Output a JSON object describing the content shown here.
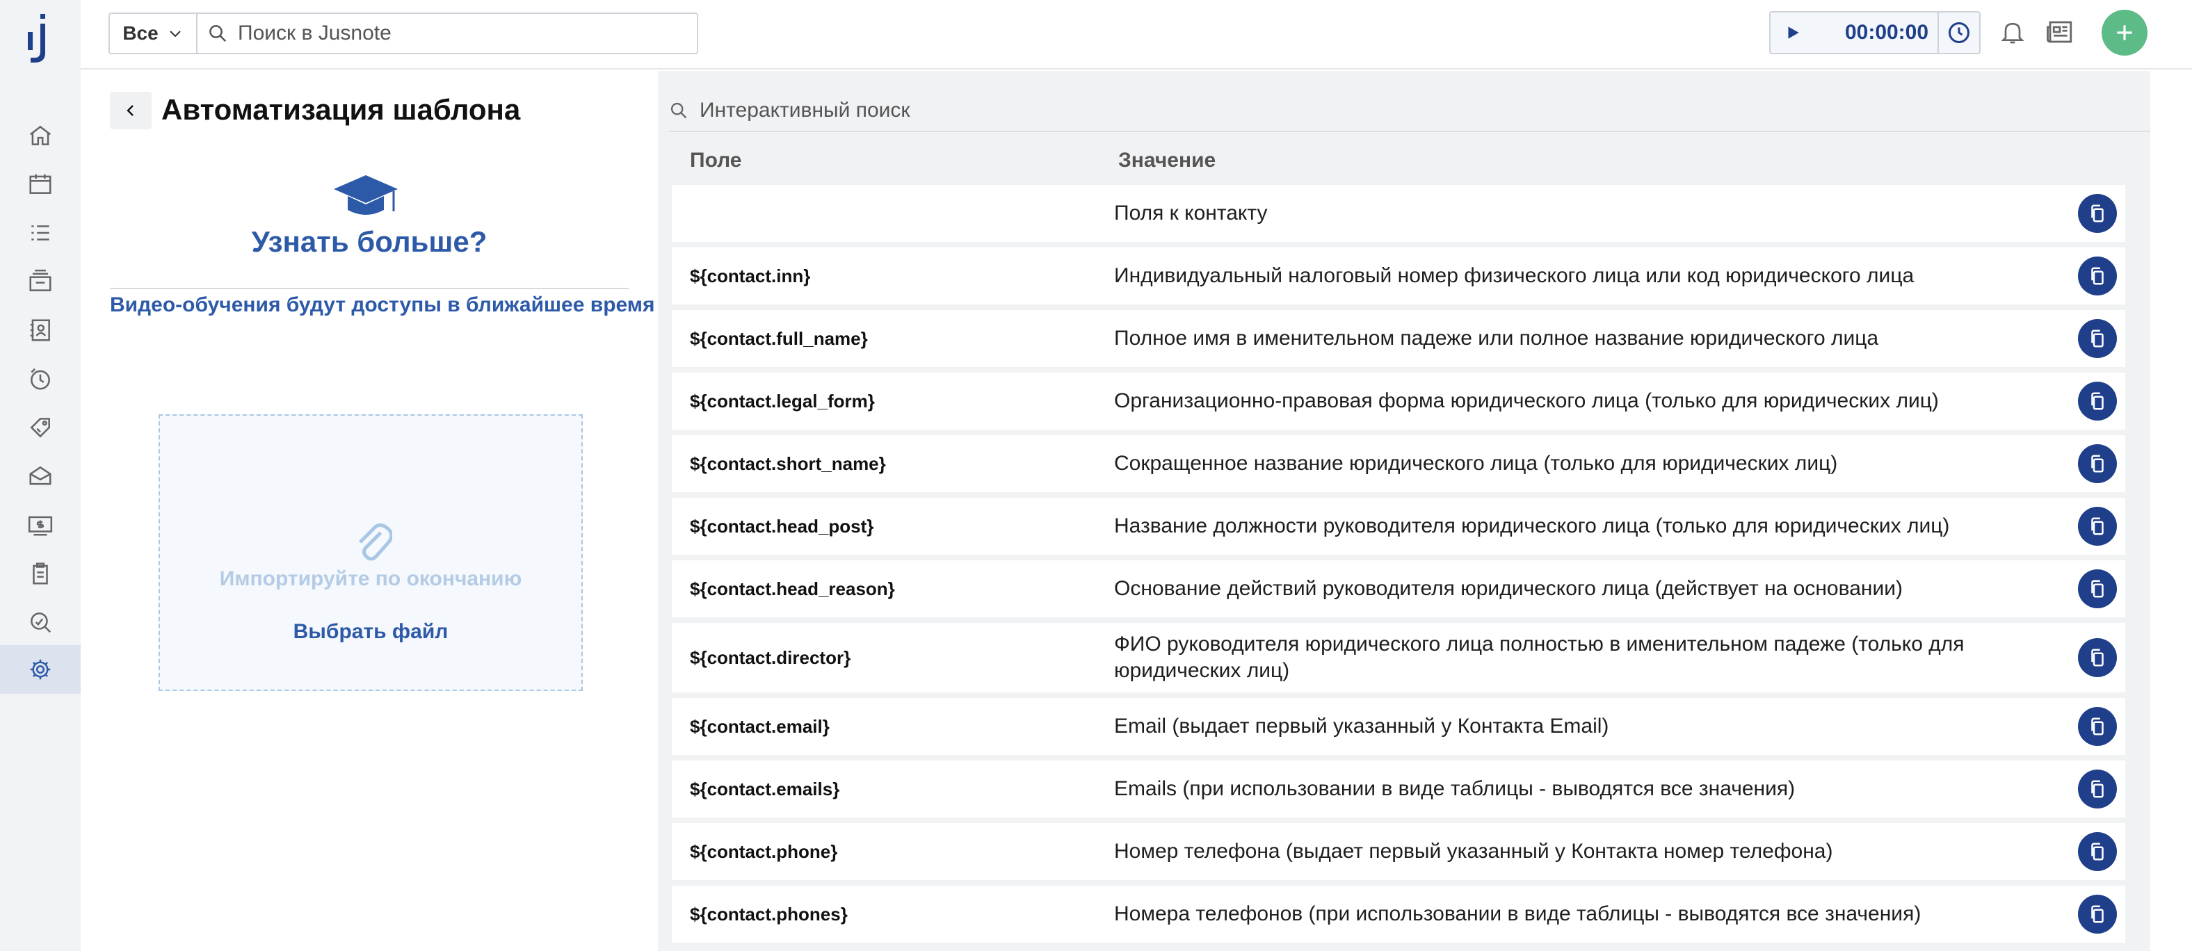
{
  "header": {
    "scope": "Все",
    "search_placeholder": "Поиск в Jusnote",
    "timer": "00:00:00"
  },
  "sidebar": {
    "items": [
      "home-icon",
      "calendar-icon",
      "tasks-icon",
      "cases-icon",
      "contacts-icon",
      "time-icon",
      "tags-icon",
      "billing-icon",
      "finance-icon",
      "documents-icon",
      "reports-icon",
      "settings-icon"
    ],
    "active": "settings-icon"
  },
  "left": {
    "title": "Автоматизация шаблона",
    "learn_more": "Узнать больше?",
    "video_note": "Видео-обучения будут доступы в ближайшее время",
    "drop_text": "Импортируйте по окончанию",
    "choose_file": "Выбрать файл"
  },
  "right": {
    "search_placeholder": "Интерактивный поиск",
    "col_field": "Поле",
    "col_value": "Значение",
    "rows": [
      {
        "field": "",
        "value": "Поля к контакту"
      },
      {
        "field": "${contact.inn}",
        "value": "Индивидуальный налоговый номер физического лица или код юридического лица"
      },
      {
        "field": "${contact.full_name}",
        "value": "Полное имя в именительном падеже или полное название юридического лица"
      },
      {
        "field": "${contact.legal_form}",
        "value": "Организационно-правовая форма юридического лица (только для юридических лиц)"
      },
      {
        "field": "${contact.short_name}",
        "value": "Сокращенное название юридического лица (только для юридических лиц)"
      },
      {
        "field": "${contact.head_post}",
        "value": "Название должности руководителя юридического лица (только для юридических лиц)"
      },
      {
        "field": "${contact.head_reason}",
        "value": "Основание действий руководителя юридического лица (действует на основании)"
      },
      {
        "field": "${contact.director}",
        "value": "ФИО руководителя юридического лица полностью в именительном падеже (только для юридических лиц)"
      },
      {
        "field": "${contact.email}",
        "value": "Email (выдает первый указанный у Контакта Email)"
      },
      {
        "field": "${contact.emails}",
        "value": "Emails (при использовании в виде таблицы - выводятся все значения)"
      },
      {
        "field": "${contact.phone}",
        "value": "Номер телефона (выдает первый указанный у Контакта номер телефона)"
      },
      {
        "field": "${contact.phones}",
        "value": "Номера телефонов (при использовании в виде таблицы - выводятся все значения)"
      }
    ]
  },
  "colors": {
    "brand_blue": "#1f3f8a",
    "link_blue": "#2d5aa8",
    "add_green": "#5dbb87",
    "sidebar_bg": "#f1f3f7"
  }
}
